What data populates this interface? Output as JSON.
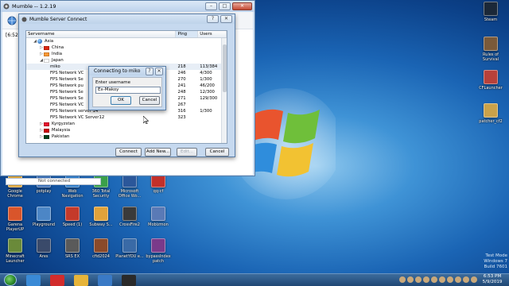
{
  "main_window": {
    "title": "Mumble -- 1.2.19",
    "log_text": "[6:52:2",
    "status": "Not connected"
  },
  "server_dialog": {
    "title": "Mumble Server Connect",
    "columns": [
      "Servername",
      "Ping",
      "Users"
    ],
    "rows": [
      {
        "name": "Asia",
        "indent": 1,
        "arrow": "down",
        "icon": "globe",
        "ping": "",
        "users": ""
      },
      {
        "name": "China",
        "indent": 2,
        "arrow": "right",
        "icon": "flag",
        "flag_color": "#de2910",
        "ping": "",
        "users": ""
      },
      {
        "name": "India",
        "indent": 2,
        "arrow": "right",
        "icon": "flag",
        "flag_color": "#ff9933",
        "ping": "",
        "users": ""
      },
      {
        "name": "Japan",
        "indent": 2,
        "arrow": "down",
        "icon": "flag",
        "flag_color": "#ffffff",
        "ping": "",
        "users": ""
      },
      {
        "name": "miko",
        "indent": 3,
        "arrow": "",
        "icon": "",
        "ping": "218",
        "users": "113/384",
        "selected": true
      },
      {
        "name": "FPS Network VC",
        "indent": 3,
        "arrow": "",
        "icon": "",
        "ping": "246",
        "users": "4/300"
      },
      {
        "name": "FPS Network Se",
        "indent": 3,
        "arrow": "",
        "icon": "",
        "ping": "270",
        "users": "1/300"
      },
      {
        "name": "FPS Network pu",
        "indent": 3,
        "arrow": "",
        "icon": "",
        "ping": "241",
        "users": "46/200"
      },
      {
        "name": "FPS Network Se",
        "indent": 3,
        "arrow": "",
        "icon": "",
        "ping": "248",
        "users": "12/300"
      },
      {
        "name": "FPS Network Se",
        "indent": 3,
        "arrow": "",
        "icon": "",
        "ping": "271",
        "users": "129/300"
      },
      {
        "name": "FPS Network VC",
        "indent": 3,
        "arrow": "",
        "icon": "",
        "ping": "267",
        "users": ""
      },
      {
        "name": "FPS Network server 14",
        "indent": 3,
        "arrow": "",
        "icon": "",
        "ping": "316",
        "users": "1/300"
      },
      {
        "name": "FPS Network VC Server12",
        "indent": 3,
        "arrow": "",
        "icon": "",
        "ping": "323",
        "users": ""
      },
      {
        "name": "Kyrgyzstan",
        "indent": 2,
        "arrow": "right",
        "icon": "flag",
        "flag_color": "#e8112d",
        "ping": "",
        "users": ""
      },
      {
        "name": "Malaysia",
        "indent": 2,
        "arrow": "right",
        "icon": "flag",
        "flag_color": "#cc0001",
        "ping": "",
        "users": ""
      },
      {
        "name": "Pakistan",
        "indent": 2,
        "arrow": "right",
        "icon": "flag",
        "flag_color": "#01411c",
        "ping": "",
        "users": ""
      }
    ],
    "buttons": {
      "connect": "Connect",
      "add_new": "Add New...",
      "edit": "Edit...",
      "cancel": "Cancel"
    }
  },
  "connect_dialog": {
    "title": "Connecting to miko",
    "label": "Enter username",
    "username": "Ex-Makoy",
    "ok": "OK",
    "cancel": "Cancel"
  },
  "desktop_icons": [
    {
      "label": "Steam",
      "color": "#1b2838"
    },
    {
      "label": "Rules of Survival",
      "color": "#7a5a3a"
    },
    {
      "label": "CFLauncher",
      "color": "#b8413a"
    },
    {
      "label": "patcher_cf2",
      "color": "#caa24a"
    },
    {
      "label": "Google Chrome",
      "color": "#d9a23a"
    },
    {
      "label": "potplay",
      "color": "#3b6fb6"
    },
    {
      "label": "Web Navigation",
      "color": "#2f7cc8"
    },
    {
      "label": "360 Total Security",
      "color": "#3aa04a"
    },
    {
      "label": "Microsoft Office Wo...",
      "color": "#2b579a"
    },
    {
      "label": "qq-cf",
      "color": "#c2302a"
    },
    {
      "label": "Garena PlayerUP",
      "color": "#d9552b"
    },
    {
      "label": "Playground",
      "color": "#4c86c6"
    },
    {
      "label": "Speed (1)",
      "color": "#c43a2a"
    },
    {
      "label": "Subway S...",
      "color": "#e0a23a"
    },
    {
      "label": "CrossFire2",
      "color": "#3a3a3a"
    },
    {
      "label": "Mobizmon",
      "color": "#5a7ab6"
    },
    {
      "label": "Minecraft Launcher",
      "color": "#6a8a3a"
    },
    {
      "label": "Ares",
      "color": "#3a4a6a"
    },
    {
      "label": "SRS EX",
      "color": "#5a5a5a"
    },
    {
      "label": "cfid2024",
      "color": "#8a4a2a"
    },
    {
      "label": "PlanetYOU e...",
      "color": "#3a6aa6"
    },
    {
      "label": "bypassIndex patch",
      "color": "#7a3a8a"
    }
  ],
  "taskbar": {
    "items": [
      {
        "name": "ie",
        "color": "#3a8ad6"
      },
      {
        "name": "opera",
        "color": "#d22c2c"
      },
      {
        "name": "chrome",
        "color": "#e6b43a"
      },
      {
        "name": "uploader",
        "color": "#3a7ac6"
      },
      {
        "name": "mumble",
        "color": "#2a2a2a"
      }
    ],
    "time": "6:53 PM",
    "date": "5/9/2019"
  },
  "watermark": {
    "line1": "Test Mode",
    "line2": "Windows 7",
    "line3": "Build 7601"
  }
}
